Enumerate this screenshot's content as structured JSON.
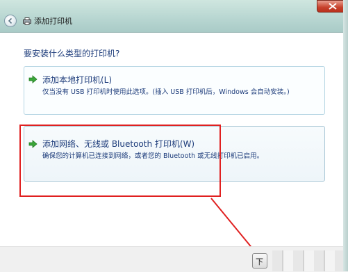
{
  "window": {
    "title": "添加打印机",
    "ghost_tabs": [
      "",
      ""
    ],
    "colors": {
      "accent": "#1c3b7a",
      "highlight": "#e02020",
      "title_bar": "#b9d7d2"
    }
  },
  "main": {
    "question": "要安装什么类型的打印机?",
    "options": [
      {
        "title": "添加本地打印机(L)",
        "description": "仅当没有 USB 打印机时使用此选项。(插入 USB 打印机后，Windows 会自动安装。)",
        "icon": "green-arrow-icon"
      },
      {
        "title": "添加网络、无线或 Bluetooth 打印机(W)",
        "description": "确保您的计算机已连接到网络，或者您的 Bluetooth 或无线打印机已启用。",
        "icon": "green-arrow-icon"
      }
    ]
  },
  "footer": {
    "next_label": "下"
  }
}
